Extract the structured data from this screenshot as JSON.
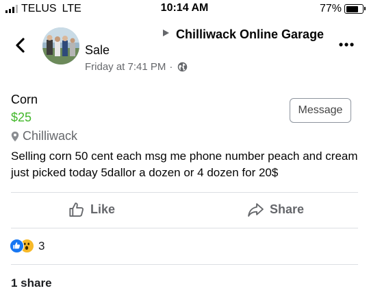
{
  "status_bar": {
    "carrier": "TELUS",
    "network": "LTE",
    "time": "10:14 AM",
    "battery": "77%",
    "battery_level": 0.77
  },
  "header": {
    "author": "Sale",
    "group": "Chilliwack Online Garage",
    "timestamp": "Friday at 7:41 PM",
    "separator": "·"
  },
  "listing": {
    "title": "Corn",
    "price": "$25",
    "location": "Chilliwack",
    "message_label": "Message",
    "description": "Selling corn 50 cent each msg me phone number peach and cream just picked today 5dallor a dozen or 4 dozen  for 20$"
  },
  "actions": {
    "like_label": "Like",
    "share_label": "Share"
  },
  "reactions": {
    "count": "3",
    "types": [
      "like",
      "wow"
    ]
  },
  "shares": {
    "label": "1 share"
  },
  "colors": {
    "price": "#42b72a",
    "like_blue": "#1877f2",
    "wow_yellow": "#f7b928",
    "muted": "#65676b"
  },
  "icons": [
    "chevron-left-icon",
    "arrow-right-icon",
    "globe-icon",
    "more-icon",
    "pin-icon",
    "thumbs-up-icon",
    "share-arrow-icon"
  ]
}
